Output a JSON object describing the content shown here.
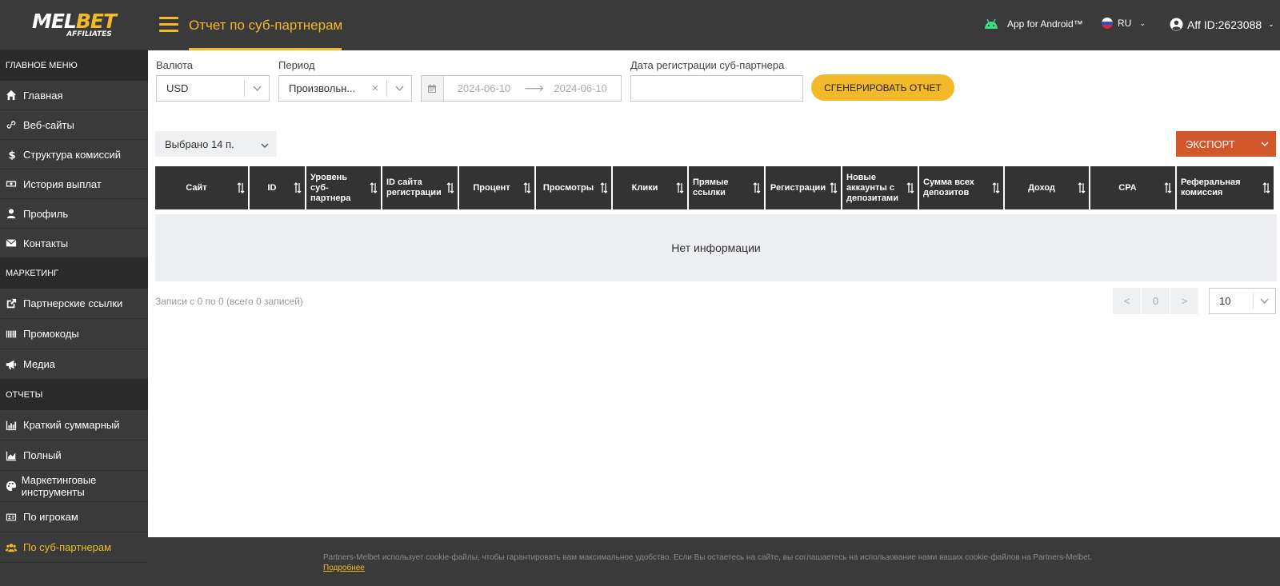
{
  "logo": {
    "main_left": "MEL",
    "main_right": "BET",
    "sub": "AFFILIATES"
  },
  "header": {
    "title": "Отчет по суб-партнерам",
    "android_label": "App for Android™",
    "lang": "RU",
    "aff_id": "Aff ID:2623088"
  },
  "sidebar": {
    "sections": [
      {
        "title": "Главное меню"
      },
      {
        "title": "Маркетинг"
      },
      {
        "title": "Отчеты"
      }
    ],
    "items": [
      {
        "label": "Главная",
        "icon": "home-icon"
      },
      {
        "label": "Веб-сайты",
        "icon": "link-icon"
      },
      {
        "label": "Структура комиссий",
        "icon": "dollar-icon"
      },
      {
        "label": "История выплат",
        "icon": "money-icon"
      },
      {
        "label": "Профиль",
        "icon": "user-icon"
      },
      {
        "label": "Контакты",
        "icon": "envelope-icon"
      },
      {
        "label": "Партнерские ссылки",
        "icon": "external-link-icon"
      },
      {
        "label": "Промокоды",
        "icon": "barcode-icon"
      },
      {
        "label": "Медиа",
        "icon": "megaphone-icon"
      },
      {
        "label": "Краткий суммарный",
        "icon": "bar-chart-icon"
      },
      {
        "label": "Полный",
        "icon": "area-chart-icon"
      },
      {
        "label": "Маркетинговые инструменты",
        "icon": "palette-icon"
      },
      {
        "label": "По игрокам",
        "icon": "id-card-icon"
      },
      {
        "label": "По суб-партнерам",
        "icon": "users-icon"
      }
    ],
    "active_index": 13
  },
  "filters": {
    "currency_label": "Валюта",
    "currency_value": "USD",
    "period_label": "Период",
    "period_value": "Произвольн...",
    "date_from": "2024-06-10",
    "date_to": "2024-06-10",
    "reg_date_label": "Дата регистрации суб-партнера",
    "reg_date_value": "",
    "generate_label": "СГЕНЕРИРОВАТЬ ОТЧЕТ"
  },
  "toolbar": {
    "columns_selected": "Выбрано 14 п.",
    "export_label": "ЭКСПОРТ"
  },
  "table": {
    "columns": [
      "Сайт",
      "ID",
      "Уровень суб-партнера",
      "ID сайта регистрации",
      "Процент",
      "Просмотры",
      "Клики",
      "Прямые ссылки",
      "Регистрации",
      "Новые аккаунты с депозитами",
      "Сумма всех депозитов",
      "Доход",
      "CPA",
      "Реферальная комиссия"
    ],
    "empty_text": "Нет информации"
  },
  "pagination": {
    "records_info": "Записи с 0 по 0 (всего 0 записей)",
    "prev": "<",
    "current": "0",
    "next": ">",
    "per_page": "10"
  },
  "cookie": {
    "text": "Partners-Melbet использует cookie-файлы, чтобы гарантировать вам максимальное удобство. Если Вы остаетесь на сайте, вы соглашаетесь на использование нами ваших cookie-файлов на Partners-Melbet.",
    "more": "Подробнее"
  },
  "colors": {
    "accent": "#f3b92a",
    "dark": "#3a3a3a",
    "export": "#d2572a",
    "android": "#3ddc84"
  }
}
